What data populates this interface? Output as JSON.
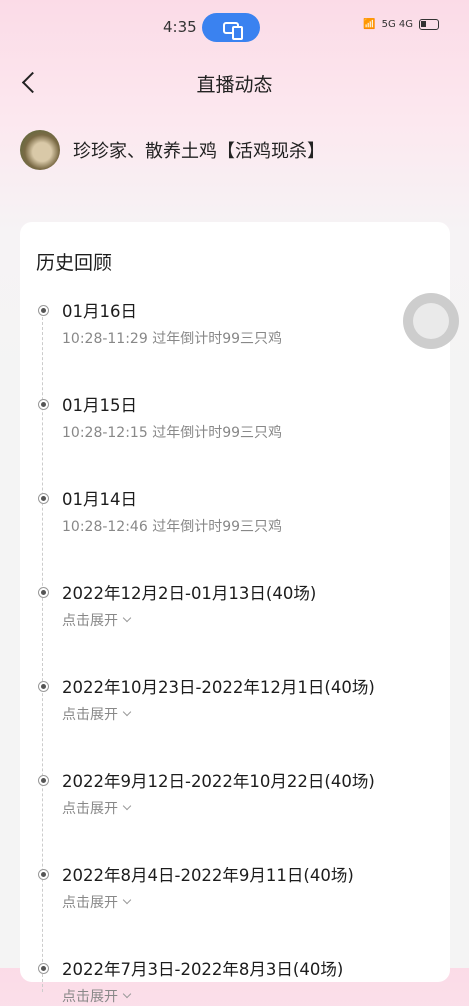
{
  "status": {
    "time": "4:35",
    "network": "5G 4G"
  },
  "nav": {
    "title": "直播动态"
  },
  "shop": {
    "name": "珍珍家、散养土鸡【活鸡现杀】"
  },
  "card": {
    "title": "历史回顾"
  },
  "items": [
    {
      "title": "01月16日",
      "sub": "10:28-11:29 过年倒计时99三只鸡"
    },
    {
      "title": "01月15日",
      "sub": "10:28-12:15 过年倒计时99三只鸡"
    },
    {
      "title": "01月14日",
      "sub": "10:28-12:46 过年倒计时99三只鸡"
    },
    {
      "title": "2022年12月2日-01月13日(40场)",
      "sub": "点击展开"
    },
    {
      "title": "2022年10月23日-2022年12月1日(40场)",
      "sub": "点击展开"
    },
    {
      "title": "2022年9月12日-2022年10月22日(40场)",
      "sub": "点击展开"
    },
    {
      "title": "2022年8月4日-2022年9月11日(40场)",
      "sub": "点击展开"
    },
    {
      "title": "2022年7月3日-2022年8月3日(40场)",
      "sub": "点击展开"
    }
  ]
}
